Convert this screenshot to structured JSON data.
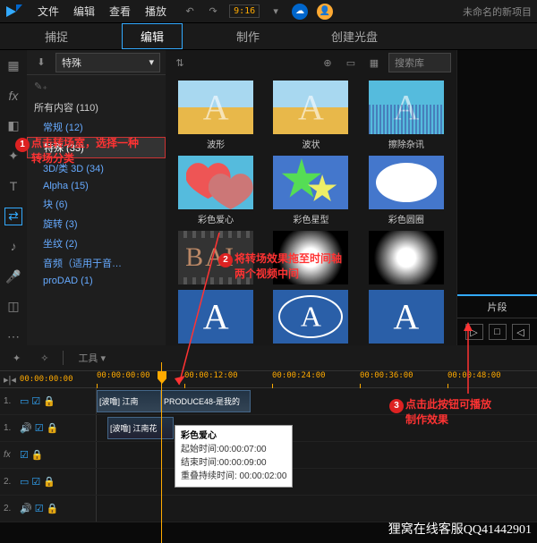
{
  "titlebar": {
    "menus": [
      "文件",
      "编辑",
      "查看",
      "播放"
    ],
    "timecode": "9:16",
    "project": "未命名的新项目"
  },
  "tabs": {
    "items": [
      "捕捉",
      "编辑",
      "制作",
      "创建光盘"
    ],
    "active": 1
  },
  "sidebar": {
    "dropdown": "特殊",
    "all_content": "所有内容 (110)",
    "items": [
      {
        "label": "常规 (12)"
      },
      {
        "label": "特殊 (33)",
        "selected": true
      },
      {
        "label": "3D/类 3D (34)"
      },
      {
        "label": "Alpha  (15)"
      },
      {
        "label": "块  (6)"
      },
      {
        "label": "旋转  (3)"
      },
      {
        "label": "坐纹  (2)"
      },
      {
        "label": "音频（适用于音…"
      },
      {
        "label": "proDAD (1)"
      }
    ]
  },
  "browser": {
    "search_placeholder": "搜索库",
    "thumbs": [
      {
        "label": "波形",
        "style": "wave"
      },
      {
        "label": "波状",
        "style": "wave"
      },
      {
        "label": "擦除杂讯",
        "style": "noise"
      },
      {
        "label": "彩色爱心",
        "style": "heart"
      },
      {
        "label": "彩色星型",
        "style": "star"
      },
      {
        "label": "彩色圆圈",
        "style": "circle"
      },
      {
        "label": "",
        "style": "film"
      },
      {
        "label": "",
        "style": "glow"
      },
      {
        "label": "",
        "style": "glow"
      },
      {
        "label": "",
        "style": "blue-a"
      },
      {
        "label": "",
        "style": "blue-a-ring"
      },
      {
        "label": "",
        "style": "blue-a"
      }
    ]
  },
  "right_panel": {
    "tab": "片段"
  },
  "toolbar": {
    "tools": "工具"
  },
  "ruler": {
    "start": "00:00:00:00",
    "marks": [
      "00:00:00:00",
      "00:00:12:00",
      "00:00:24:00",
      "00:00:36:00",
      "00:00:48:00"
    ]
  },
  "tracks": {
    "t1": {
      "num": "1.",
      "clip1": "[波噜]  江南",
      "clip2": "PRODUCE48-是我的"
    },
    "t1a": {
      "clip": "[波噜]  江南花"
    },
    "fx": {
      "num": "fx"
    },
    "t2": {
      "num": "2."
    }
  },
  "tooltip": {
    "title": "彩色爱心",
    "start": "起始时间:00:00:07:00",
    "end": "结束时间:00:00:09:00",
    "overlap": "重叠持续时间:  00:00:02:00"
  },
  "annotations": {
    "a1": {
      "num": "1",
      "text1": "点击转场室，选择一种",
      "text2": "转场分类"
    },
    "a2": {
      "num": "2",
      "text1": "将转场效果拖至时间轴",
      "text2": "两个视频中间"
    },
    "a3": {
      "num": "3",
      "text1": "点击此按钮可播放",
      "text2": "制作效果"
    }
  },
  "watermark": "狸窝在线客服QQ41442901"
}
